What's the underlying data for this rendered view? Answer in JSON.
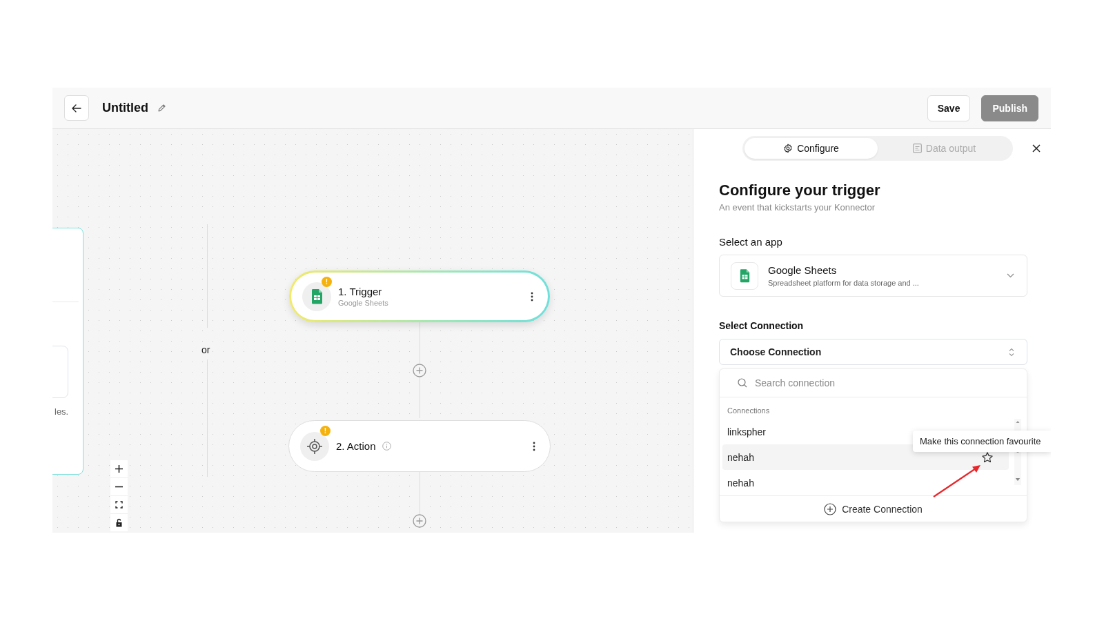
{
  "header": {
    "title": "Untitled",
    "buttons": [
      {
        "label": "Save",
        "kind": "secondary"
      },
      {
        "label": "Publish",
        "kind": "primary"
      }
    ]
  },
  "canvas": {
    "side_card": {
      "text": "les."
    },
    "or_label": "or",
    "nodes": [
      {
        "kind": "trigger",
        "title": "1. Trigger",
        "subtitle": "Google Sheets",
        "badge": "!",
        "selected": true
      },
      {
        "kind": "action",
        "title": "2. Action",
        "badge": "!",
        "selected": false
      }
    ]
  },
  "panel": {
    "tabs": [
      {
        "label": "Configure",
        "selected": true
      },
      {
        "label": "Data output",
        "selected": false
      }
    ],
    "heading": "Configure your trigger",
    "subheading": "An event that kickstarts your Konnector",
    "app_section": {
      "label": "Select an app",
      "app_name": "Google Sheets",
      "app_description": "Spreadsheet platform for data storage and ..."
    },
    "connection_section": {
      "label": "Select Connection",
      "value": "Choose Connection",
      "dropdown": {
        "search_placeholder": "Search connection",
        "group_label": "Connections",
        "items": [
          {
            "label": "linkspher",
            "hovered": false
          },
          {
            "label": "nehah",
            "hovered": true
          },
          {
            "label": "nehah",
            "hovered": false
          }
        ],
        "create_label": "Create Connection"
      }
    },
    "tooltip": "Make this connection favourite"
  }
}
